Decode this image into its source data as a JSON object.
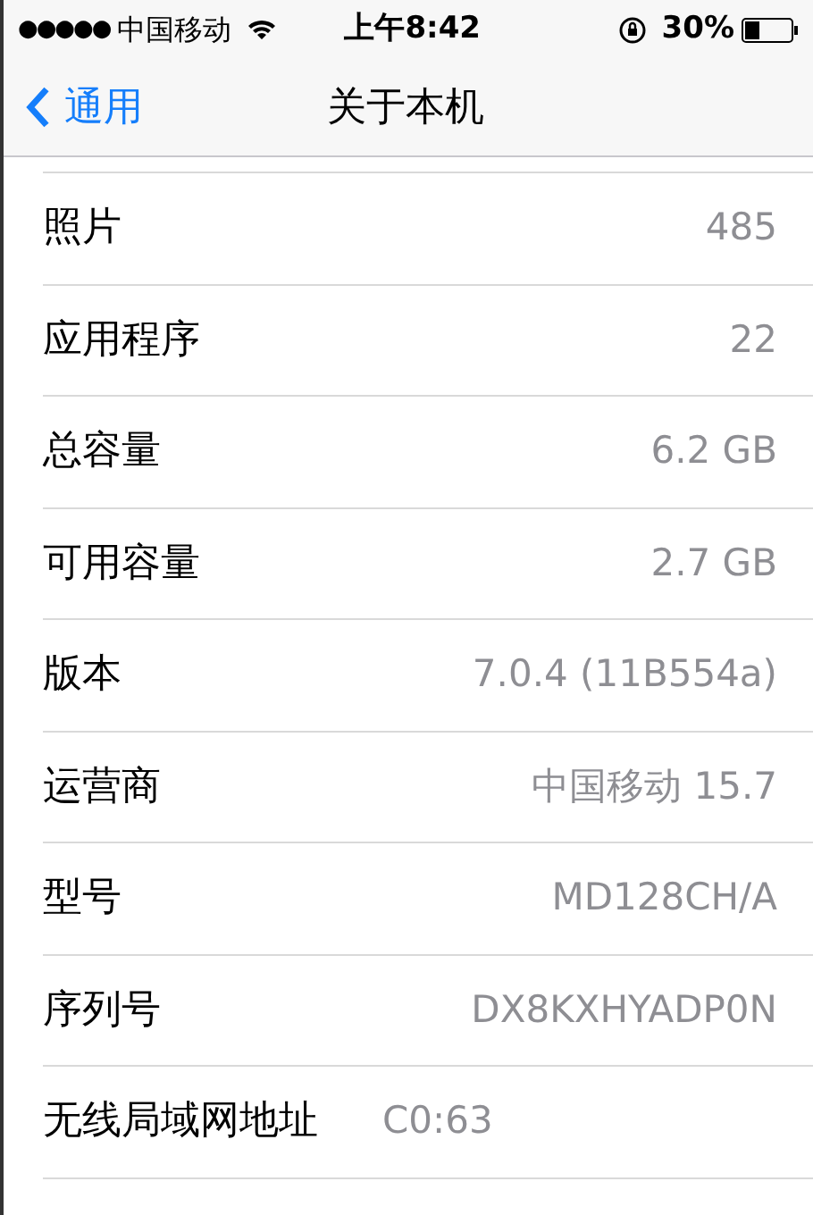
{
  "status_bar": {
    "signal_dots": "●●●●●",
    "carrier": "中国移动",
    "time": "上午8:42",
    "battery": "30%"
  },
  "nav": {
    "back": "通用",
    "title": "关于本机"
  },
  "rows": [
    {
      "label": "照片",
      "value": "485"
    },
    {
      "label": "应用程序",
      "value": "22"
    },
    {
      "label": "总容量",
      "value": "6.2 GB"
    },
    {
      "label": "可用容量",
      "value": "2.7 GB"
    },
    {
      "label": "版本",
      "value": "7.0.4 (11B554a)"
    },
    {
      "label": "运营商",
      "value": "中国移动 15.7"
    },
    {
      "label": "型号",
      "value": "MD128CH/A"
    },
    {
      "label": "序列号",
      "value": "DX8KXHYADP0N"
    },
    {
      "label": "无线局域网地址",
      "value": "C0:63"
    }
  ]
}
